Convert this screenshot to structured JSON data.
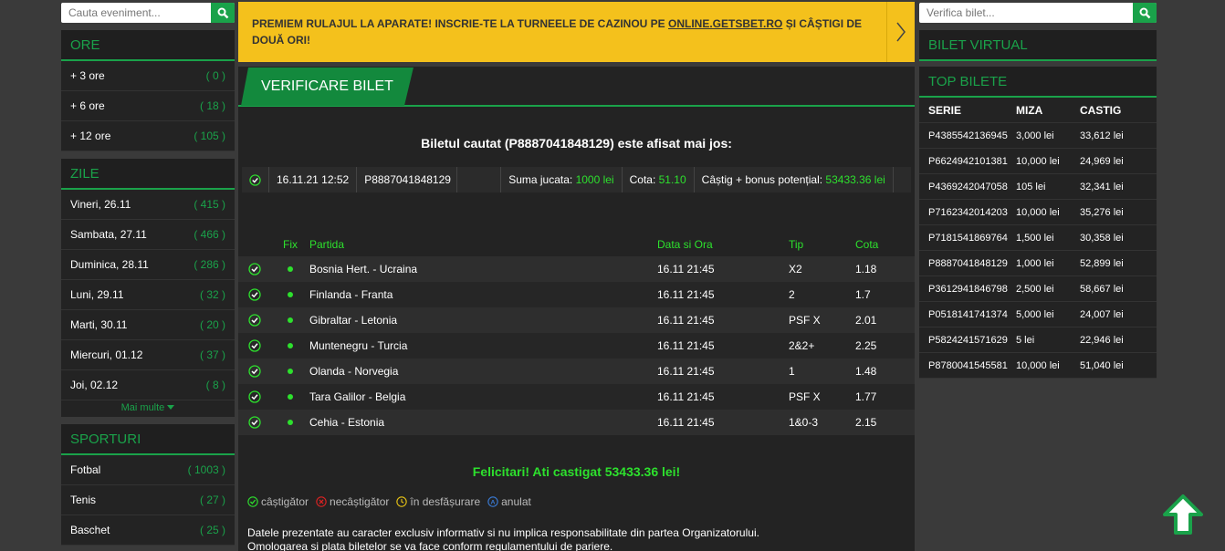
{
  "left": {
    "search_placeholder": "Cauta eveniment...",
    "ore": {
      "title": "ORE",
      "items": [
        {
          "label": "+ 3 ore",
          "count": "( 0 )"
        },
        {
          "label": "+ 6 ore",
          "count": "( 18 )"
        },
        {
          "label": "+ 12 ore",
          "count": "( 105 )"
        }
      ]
    },
    "zile": {
      "title": "ZILE",
      "items": [
        {
          "label": "Vineri, 26.11",
          "count": "( 415 )"
        },
        {
          "label": "Sambata, 27.11",
          "count": "( 466 )"
        },
        {
          "label": "Duminica, 28.11",
          "count": "( 286 )"
        },
        {
          "label": "Luni, 29.11",
          "count": "( 32 )"
        },
        {
          "label": "Marti, 30.11",
          "count": "( 20 )"
        },
        {
          "label": "Miercuri, 01.12",
          "count": "( 37 )"
        },
        {
          "label": "Joi, 02.12",
          "count": "( 8 )"
        }
      ],
      "more": "Mai multe"
    },
    "sporturi": {
      "title": "SPORTURI",
      "items": [
        {
          "label": "Fotbal",
          "count": "( 1003 )"
        },
        {
          "label": "Tenis",
          "count": "( 27 )"
        },
        {
          "label": "Baschet",
          "count": "( 25 )"
        }
      ]
    }
  },
  "promo": {
    "text_before": "PREMIEM RULAJUL LA APARATE! INSCRIE-TE LA TURNEELE DE CAZINOU PE ",
    "link": "ONLINE.GETSBET.RO",
    "text_after": " ȘI CÂȘTIGI DE DOUĂ ORI!"
  },
  "verify": {
    "tab_label": "VERIFICARE BILET",
    "found_text": "Biletul cautat (P8887041848129) este afisat mai jos:",
    "ticket": {
      "date": "16.11.21 12:52",
      "code": "P8887041848129",
      "stake_label": "Suma jucata: ",
      "stake_value": "1000 lei",
      "odds_label": "Cota: ",
      "odds_value": "51.10",
      "win_label": "Câștig + bonus potențial: ",
      "win_value": "53433.36 lei"
    },
    "columns": {
      "fix": "Fix",
      "match": "Partida",
      "datetime": "Data si Ora",
      "tip": "Tip",
      "odds": "Cota"
    },
    "rows": [
      {
        "match": "Bosnia Hert. - Ucraina",
        "datetime": "16.11 21:45",
        "tip": "X2",
        "odds": "1.18"
      },
      {
        "match": "Finlanda - Franta",
        "datetime": "16.11 21:45",
        "tip": "2",
        "odds": "1.7"
      },
      {
        "match": "Gibraltar - Letonia",
        "datetime": "16.11 21:45",
        "tip": "PSF X",
        "odds": "2.01"
      },
      {
        "match": "Muntenegru - Turcia",
        "datetime": "16.11 21:45",
        "tip": "2&2+",
        "odds": "2.25"
      },
      {
        "match": "Olanda - Norvegia",
        "datetime": "16.11 21:45",
        "tip": "1",
        "odds": "1.48"
      },
      {
        "match": "Tara Galilor - Belgia",
        "datetime": "16.11 21:45",
        "tip": "PSF X",
        "odds": "1.77"
      },
      {
        "match": "Cehia - Estonia",
        "datetime": "16.11 21:45",
        "tip": "1&0-3",
        "odds": "2.15"
      }
    ],
    "congrats": "Felicitari! Ati castigat 53433.36 lei!",
    "legend": {
      "won": "câștigător",
      "lost": "necâștigător",
      "pending": "în desfășurare",
      "cancelled": "anulat"
    },
    "disclaimer_1": "Datele prezentate au caracter exclusiv informativ si nu implica responsabilitate din partea Organizatorului.",
    "disclaimer_2": "Omologarea si plata biletelor se va face conform regulamentului de pariere."
  },
  "right": {
    "search_placeholder": "Verifica bilet...",
    "virtual_title": "BILET VIRTUAL",
    "top_title": "TOP BILETE",
    "columns": {
      "serie": "SERIE",
      "miza": "MIZA",
      "castig": "CASTIG"
    },
    "rows": [
      {
        "serie": "P4385542136945",
        "miza": "3,000 lei",
        "castig": "33,612 lei"
      },
      {
        "serie": "P6624942101381",
        "miza": "10,000 lei",
        "castig": "24,969 lei"
      },
      {
        "serie": "P4369242047058",
        "miza": "105 lei",
        "castig": "32,341 lei"
      },
      {
        "serie": "P7162342014203",
        "miza": "10,000 lei",
        "castig": "35,276 lei"
      },
      {
        "serie": "P7181541869764",
        "miza": "1,500 lei",
        "castig": "30,358 lei"
      },
      {
        "serie": "P8887041848129",
        "miza": "1,000 lei",
        "castig": "52,899 lei"
      },
      {
        "serie": "P3612941846798",
        "miza": "2,500 lei",
        "castig": "58,667 lei"
      },
      {
        "serie": "P0518141741374",
        "miza": "5,000 lei",
        "castig": "24,007 lei"
      },
      {
        "serie": "P5824241571629",
        "miza": "5 lei",
        "castig": "22,946 lei"
      },
      {
        "serie": "P8780041545581",
        "miza": "10,000 lei",
        "castig": "51,040 lei"
      }
    ]
  },
  "colors": {
    "accent": "#1aa24a",
    "promo": "#f4c11c",
    "win": "#2de02d"
  },
  "icons": [
    "search-icon",
    "chevron-right-icon",
    "check-circle-icon",
    "status-dot-icon",
    "x-circle-icon",
    "clock-icon",
    "cancel-circle-icon",
    "arrow-up-icon",
    "caret-down-icon"
  ]
}
